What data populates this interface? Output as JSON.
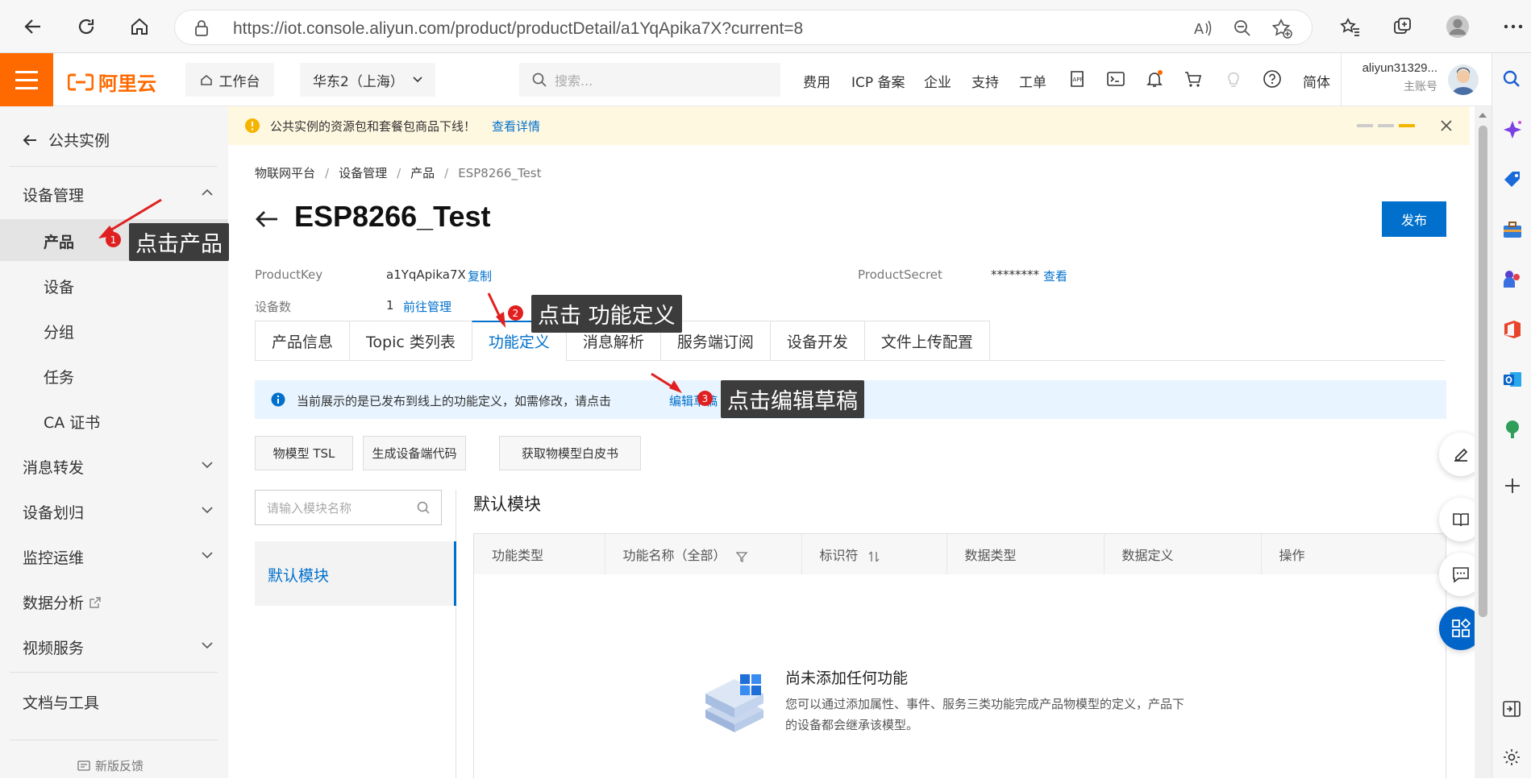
{
  "browser": {
    "url": "https://iot.console.aliyun.com/product/productDetail/a1YqApika7X?current=8"
  },
  "topnav": {
    "logo": "阿里云",
    "workbench": "工作台",
    "region": "华东2（上海）",
    "search_placeholder": "搜索...",
    "items": [
      "费用",
      "ICP 备案",
      "企业",
      "支持",
      "工单"
    ],
    "lang": "简体",
    "account": "aliyun31329...",
    "account_sub": "主账号",
    "brand_color": "#ff6a00"
  },
  "sidebar": {
    "back_label": "公共实例",
    "groups": [
      {
        "label": "设备管理",
        "expanded": true,
        "items": [
          "产品",
          "设备",
          "分组",
          "任务",
          "CA 证书"
        ]
      },
      {
        "label": "消息转发",
        "expanded": false
      },
      {
        "label": "设备划归",
        "expanded": false
      },
      {
        "label": "监控运维",
        "expanded": false
      },
      {
        "label": "数据分析",
        "expanded": false
      },
      {
        "label": "视频服务",
        "expanded": false
      }
    ],
    "docs": "文档与工具",
    "feedback": "新版反馈",
    "active_item": "产品"
  },
  "banner": {
    "text": "公共实例的资源包和套餐包商品下线！",
    "link": "查看详情"
  },
  "breadcrumb": [
    "物联网平台",
    "设备管理",
    "产品",
    "ESP8266_Test"
  ],
  "product": {
    "title": "ESP8266_Test",
    "publish": "发布",
    "key_label": "ProductKey",
    "key_value": "a1YqApika7X",
    "copy": "复制",
    "secret_label": "ProductSecret",
    "secret_value": "********",
    "view": "查看",
    "device_count_label": "设备数",
    "device_count": "1",
    "manage_link": "前往管理"
  },
  "tabs": [
    "产品信息",
    "Topic 类列表",
    "功能定义",
    "消息解析",
    "服务端订阅",
    "设备开发",
    "文件上传配置"
  ],
  "active_tab": "功能定义",
  "info": {
    "text": "当前展示的是已发布到线上的功能定义，如需修改，请点击",
    "link": "编辑草稿"
  },
  "actions": [
    "物模型 TSL",
    "生成设备端代码",
    "获取物模型白皮书"
  ],
  "module": {
    "search_placeholder": "请输入模块名称",
    "default": "默认模块",
    "section_title": "默认模块"
  },
  "table": {
    "headers": [
      "功能类型",
      "功能名称（全部）",
      "标识符",
      "数据类型",
      "数据定义",
      "操作"
    ]
  },
  "empty": {
    "title": "尚未添加任何功能",
    "desc_line1": "您可以通过添加属性、事件、服务三类功能完成产品物模型的定义，产品下",
    "desc_line2": "的设备都会继承该模型。"
  },
  "annotations": [
    {
      "badge": "1",
      "text": "点击产品"
    },
    {
      "badge": "2",
      "text": "点击 功能定义"
    },
    {
      "badge": "3",
      "text": "点击编辑草稿"
    }
  ],
  "colors": {
    "accent": "#0070cc",
    "annotation_bg": "#3c3c3c",
    "badge": "#e02020",
    "warning_bg": "#fff8e1"
  }
}
